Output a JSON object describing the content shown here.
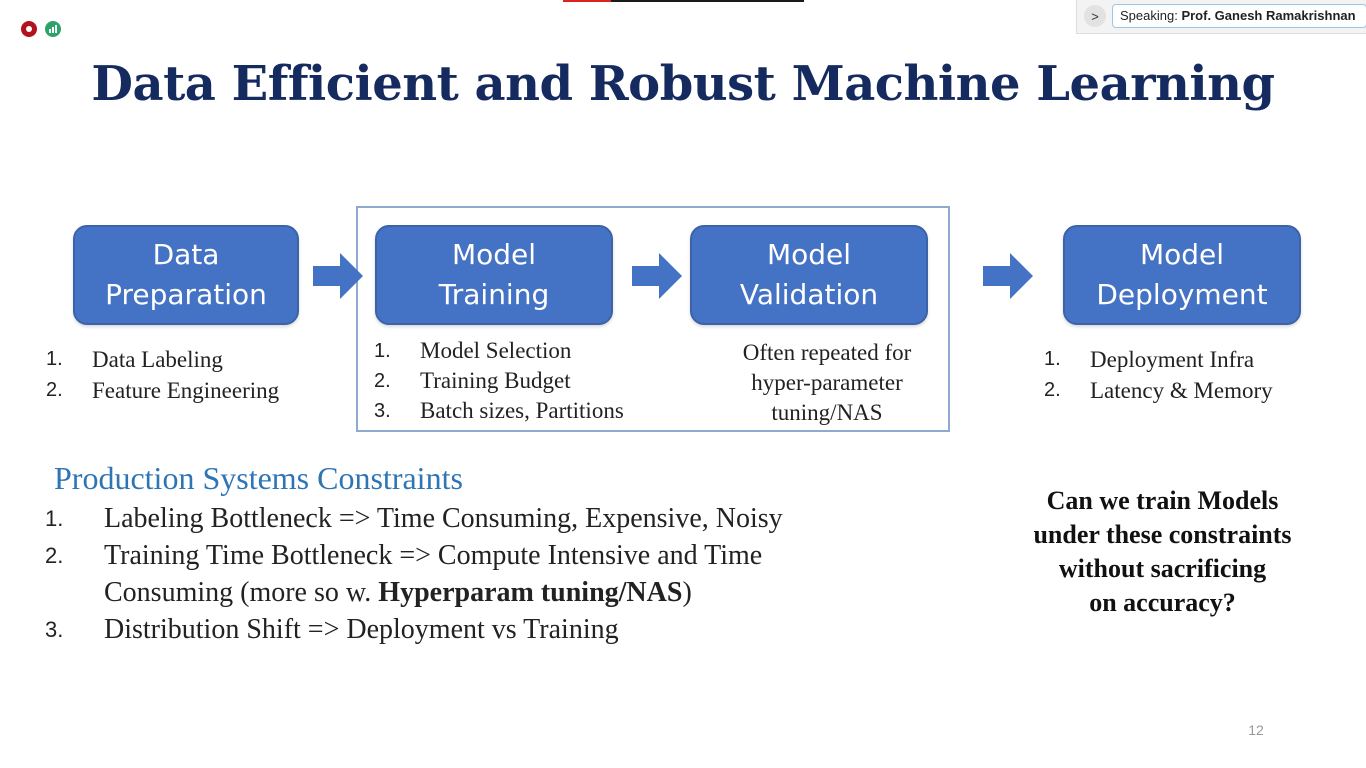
{
  "meeting": {
    "speaking_label": "Speaking:",
    "speaker_name": "Prof. Ganesh Ramakrishnan",
    "collapse_glyph": ">",
    "record_color": "#b3121d",
    "signal_color": "#2ba36b"
  },
  "slide": {
    "title": "Data Efficient and Robust Machine Learning",
    "stages": [
      {
        "line1": "Data",
        "line2": "Preparation"
      },
      {
        "line1": "Model",
        "line2": "Training"
      },
      {
        "line1": "Model",
        "line2": "Validation"
      },
      {
        "line1": "Model",
        "line2": "Deployment"
      }
    ],
    "prep_items": [
      "Data Labeling",
      "Feature Engineering"
    ],
    "training_items": [
      "Model Selection",
      "Training Budget",
      "Batch sizes, Partitions"
    ],
    "validation_note": {
      "line1": "Often repeated for",
      "line2": "hyper-parameter",
      "line3": "tuning/NAS"
    },
    "deployment_items": [
      "Deployment Infra",
      "Latency & Memory"
    ],
    "constraints_heading": "Production Systems Constraints",
    "constraints": {
      "item1": "Labeling Bottleneck => Time Consuming, Expensive, Noisy",
      "item2_prefix": "Training Time Bottleneck => Compute Intensive and Time Consuming (more so w. ",
      "item2_bold": "Hyperparam tuning/NAS",
      "item2_suffix": ")",
      "item3": "Distribution Shift  => Deployment vs Training"
    },
    "question": {
      "line1": "Can we train Models",
      "line2": "under these constraints",
      "line3": "without sacrificing",
      "line4": "on accuracy?"
    },
    "page_number": "12",
    "colors": {
      "title": "#152a5e",
      "stage_fill": "#4472c4",
      "arrow": "#4472c4",
      "heading": "#2e75b6"
    }
  }
}
